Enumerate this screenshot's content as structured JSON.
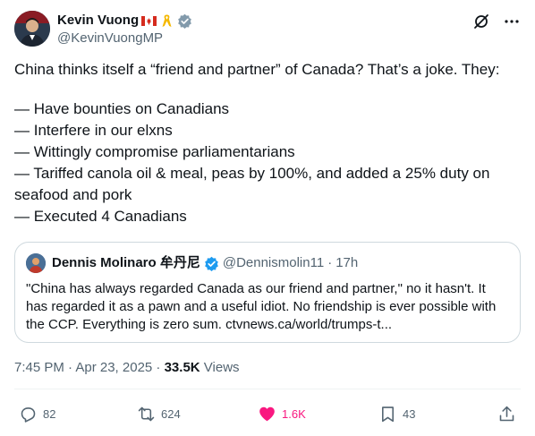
{
  "author": {
    "name": "Kevin Vuong",
    "handle": "@KevinVuongMP",
    "icons": [
      "canada-flag-icon",
      "yellow-ribbon-icon",
      "verified-badge-icon"
    ]
  },
  "tweet": {
    "intro": "China thinks itself a “friend and partner” of Canada? That’s a joke. They:",
    "lines": [
      "— Have bounties on Canadians",
      "— Interfere in our elxns",
      "— Wittingly compromise parliamentarians",
      "— Tariffed canola oil & meal, peas by 100%, and added a 25% duty on",
      "seafood and pork",
      "— Executed 4 Canadians"
    ]
  },
  "quote": {
    "name": "Dennis Molinaro 牟丹尼",
    "handle": "@Dennismolin11",
    "separator": "·",
    "time": "17h",
    "lines": [
      "\"China has always regarded Canada as our friend and partner,\" no it hasn't. It",
      "has regarded it as a pawn and a useful idiot. No friendship is ever possible with",
      "the CCP. Everything is zero sum. ctvnews.ca/world/trumps-t..."
    ]
  },
  "meta": {
    "timestamp": "7:45 PM · Apr 23, 2025 · ",
    "views_count": "33.5K",
    "views_label": " Views"
  },
  "actions": {
    "replies": "82",
    "reposts": "624",
    "likes": "1.6K",
    "bookmarks": "43"
  },
  "colors": {
    "text": "#0f1419",
    "secondary": "#536471",
    "like_pink": "#f91880",
    "verified_blue": "#1d9bf0",
    "border": "#cfd9de"
  }
}
